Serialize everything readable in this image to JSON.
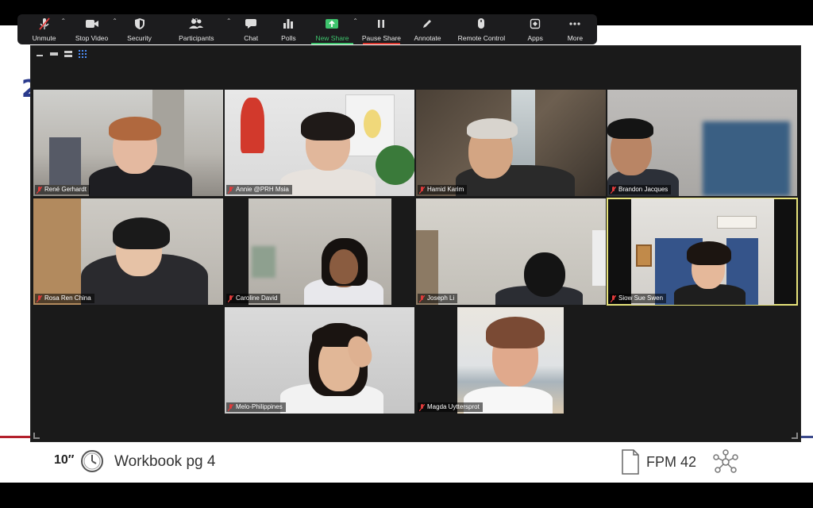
{
  "toolbar": {
    "items": [
      {
        "label": "Unmute",
        "icon": "mic-muted-icon",
        "caret": true
      },
      {
        "label": "Stop Video",
        "icon": "video-camera-icon",
        "caret": true
      },
      {
        "label": "Security",
        "icon": "shield-icon",
        "caret": false
      },
      {
        "label": "Participants",
        "icon": "participants-icon",
        "caret": true,
        "count": "10"
      },
      {
        "label": "Chat",
        "icon": "chat-bubble-icon",
        "caret": false
      },
      {
        "label": "Polls",
        "icon": "bar-chart-icon",
        "caret": false
      },
      {
        "label": "New Share",
        "icon": "share-screen-icon",
        "caret": true
      },
      {
        "label": "Pause Share",
        "icon": "pause-icon",
        "caret": false
      },
      {
        "label": "Annotate",
        "icon": "pen-icon",
        "caret": false
      },
      {
        "label": "Remote Control",
        "icon": "mouse-icon",
        "caret": false
      },
      {
        "label": "Apps",
        "icon": "apps-icon",
        "caret": false
      },
      {
        "label": "More",
        "icon": "ellipsis-icon",
        "caret": false
      }
    ],
    "colors": {
      "green": "#3ec46d",
      "bar_bg": "#1c1c1e",
      "pause_underline": "#d9342b"
    }
  },
  "participants": [
    {
      "name": "René Gerhardt"
    },
    {
      "name": "Annie @PRH Msia"
    },
    {
      "name": "Hamid Karim"
    },
    {
      "name": "Brandon Jacques"
    },
    {
      "name": "Rosa Ren China"
    },
    {
      "name": "Caroline David"
    },
    {
      "name": "Joseph Li"
    },
    {
      "name": "Siow Sue Swen"
    },
    {
      "name": "Melo-Philippines"
    },
    {
      "name": "Magda Uyttersprot"
    }
  ],
  "slide": {
    "timer": "10″",
    "workbook": "Workbook pg 4",
    "module": "FPM 42",
    "accent_red": "#b3202c",
    "accent_blue": "#3c4a8c"
  },
  "active_speaker_color": "#e6e27a"
}
